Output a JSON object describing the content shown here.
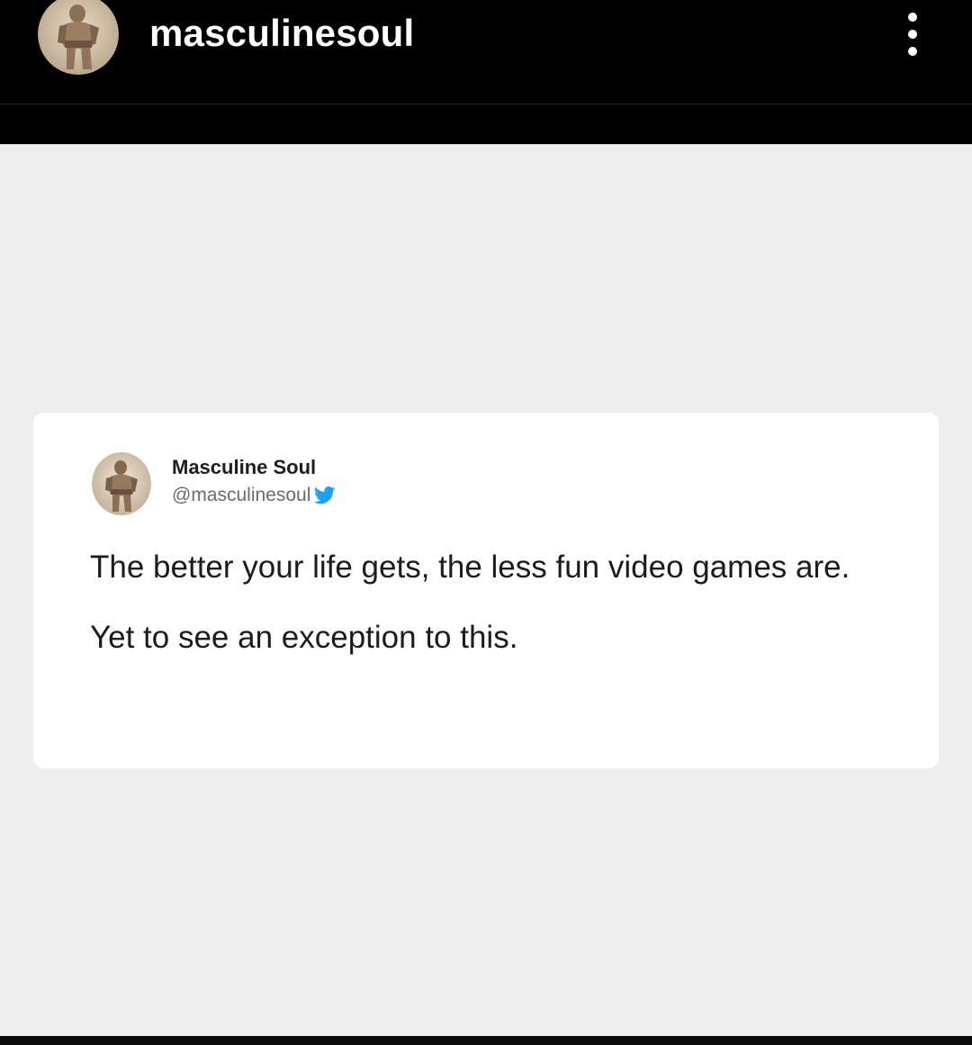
{
  "header": {
    "username": "masculinesoul",
    "avatar_icon": "statue-avatar-icon",
    "more_icon": "more-vertical-icon"
  },
  "tweet": {
    "display_name": "Masculine Soul",
    "handle": "@masculinesoul",
    "platform_icon": "twitter-bird-icon",
    "brand_color": "#1da1f2",
    "paragraphs": [
      "The better your life gets, the less fun video games are.",
      "Yet to see an exception to this."
    ]
  },
  "colors": {
    "header_background": "#000000",
    "image_background": "#eeeeee",
    "card_background": "#ffffff"
  }
}
